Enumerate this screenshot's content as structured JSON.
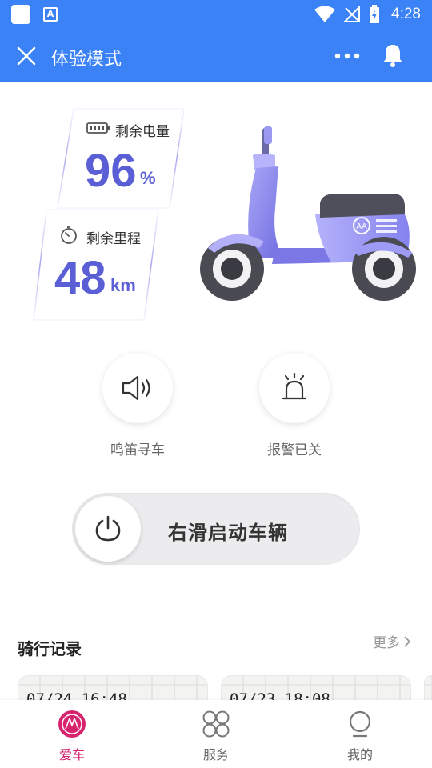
{
  "status_bar": {
    "time": "4:28",
    "app_badge": "A"
  },
  "header": {
    "title": "体验模式"
  },
  "battery": {
    "label": "剩余电量",
    "value": "96",
    "unit": "%"
  },
  "range": {
    "label": "剩余里程",
    "value": "48",
    "unit": "km"
  },
  "actions": {
    "horn_label": "鸣笛寻车",
    "alarm_label": "报警已关"
  },
  "start_slider": {
    "label": "右滑启动车辆"
  },
  "ride_records": {
    "title": "骑行记录",
    "more_label": "更多",
    "items": [
      {
        "time": "07/24 16:48"
      },
      {
        "time": "07/23 18:08"
      }
    ]
  },
  "bottom_nav": {
    "items": [
      {
        "label": "爱车",
        "active": true
      },
      {
        "label": "服务",
        "active": false
      },
      {
        "label": "我的",
        "active": false
      }
    ]
  },
  "colors": {
    "primary_blue": "#3b82f6",
    "accent_purple": "#5b5fd6",
    "active_pink": "#d6246e",
    "scooter_body": "#8c89f0"
  }
}
